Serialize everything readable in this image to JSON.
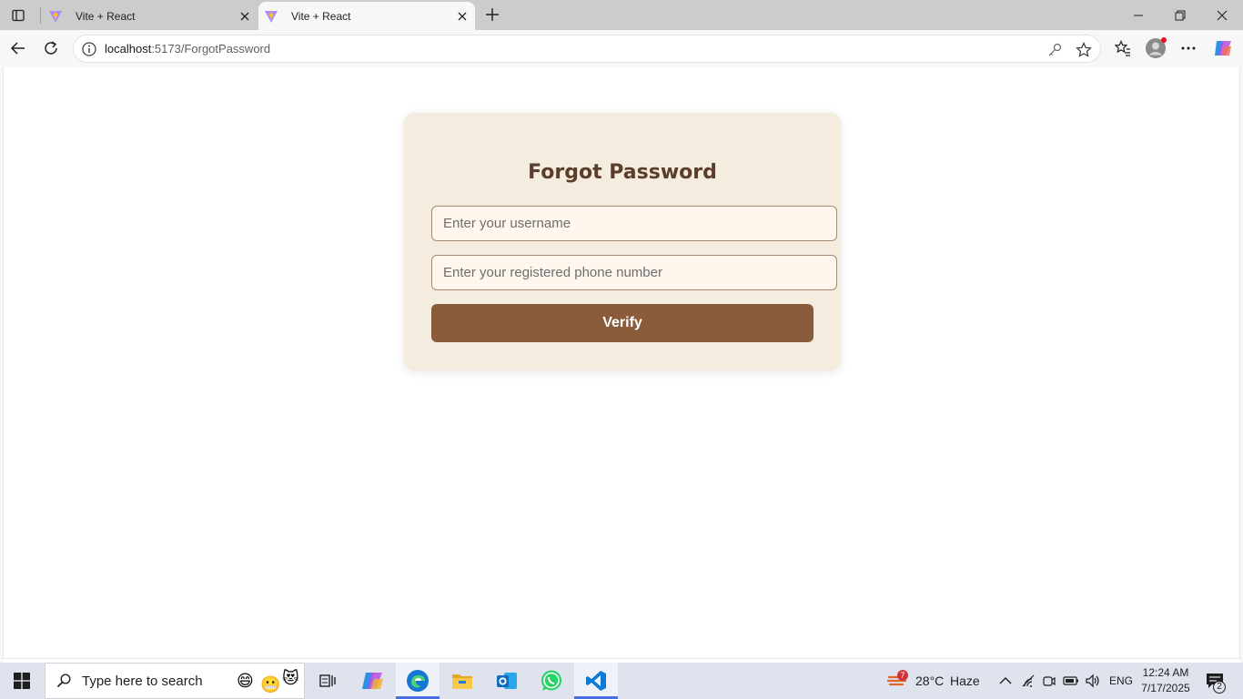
{
  "browser": {
    "tabs": [
      {
        "title": "Vite + React",
        "active": false
      },
      {
        "title": "Vite + React",
        "active": true
      }
    ],
    "url": {
      "host": "localhost",
      "path": ":5173/ForgotPassword"
    }
  },
  "page": {
    "title": "Forgot Password",
    "username_placeholder": "Enter your username",
    "phone_placeholder": "Enter your registered phone number",
    "verify_label": "Verify"
  },
  "taskbar": {
    "search_placeholder": "Type here to search",
    "weather": {
      "temp": "28°C",
      "condition": "Haze",
      "badge": "7"
    },
    "language": "ENG",
    "time": "12:24 AM",
    "date": "7/17/2025",
    "notifications": "2"
  },
  "colors": {
    "card_bg": "#f5ece0",
    "title": "#5b3d2b",
    "button": "#8a5c3b",
    "input_bg": "#fff7ee",
    "input_border": "#a48a73"
  }
}
